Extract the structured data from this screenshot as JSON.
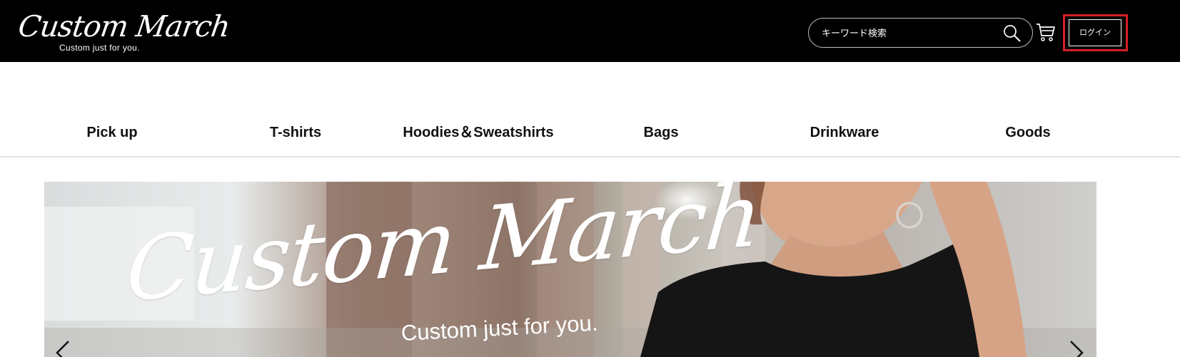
{
  "header": {
    "logo": {
      "title": "Custom March",
      "tagline": "Custom just for you."
    },
    "search": {
      "placeholder": "キーワード検索",
      "icon": "search-icon"
    },
    "cart": {
      "icon": "cart-icon"
    },
    "login": {
      "label": "ログイン",
      "highlight_color": "#d61f26"
    }
  },
  "nav": {
    "items": [
      {
        "label": "Pick up"
      },
      {
        "label": "T-shirts"
      },
      {
        "label": "Hoodies＆Sweatshirts"
      },
      {
        "label": "Bags"
      },
      {
        "label": "Drinkware"
      },
      {
        "label": "Goods"
      }
    ]
  },
  "hero": {
    "title": "Custom March",
    "subtitle": "Custom just for you.",
    "prev_icon": "chevron-left-icon",
    "next_icon": "chevron-right-icon"
  },
  "colors": {
    "header_background": "#000000",
    "page_background": "#ffffff",
    "text": "#111111"
  }
}
